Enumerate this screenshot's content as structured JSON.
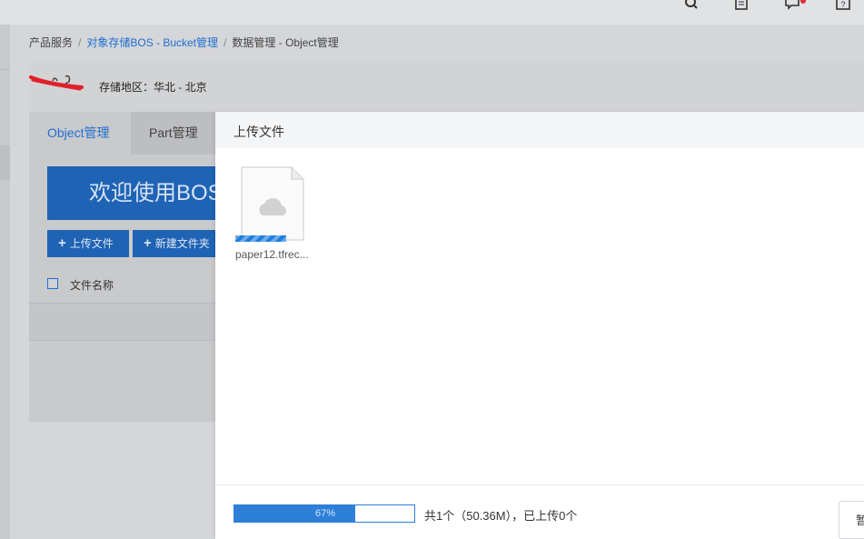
{
  "header": {
    "icons": [
      "search-icon",
      "document-icon",
      "message-icon",
      "help-icon"
    ]
  },
  "breadcrumb": {
    "items": [
      "产品服务",
      "对象存储BOS - Bucket管理",
      "数据管理 - Object管理"
    ],
    "separator": "/"
  },
  "bucket": {
    "region_label": "存储地区：华北 - 北京"
  },
  "tabs": [
    {
      "label": "Object管理",
      "active": true
    },
    {
      "label": "Part管理",
      "active": false
    }
  ],
  "welcome_banner": "欢迎使用BOS",
  "toolbar": {
    "upload_label": "上传文件",
    "new_folder_label": "新建文件夹"
  },
  "file_table": {
    "columns": [
      "文件名称"
    ]
  },
  "upload_dialog": {
    "title": "上传文件",
    "file": {
      "name": "paper12.tfrec..."
    },
    "progress": {
      "percent": 67,
      "text": "67%"
    },
    "summary": "共1个（50.36M），已上传0个",
    "pause_label": "暂"
  },
  "colors": {
    "accent": "#1f6fd0",
    "primary_button": "#1f63b5",
    "progress": "#2d7fd8"
  }
}
